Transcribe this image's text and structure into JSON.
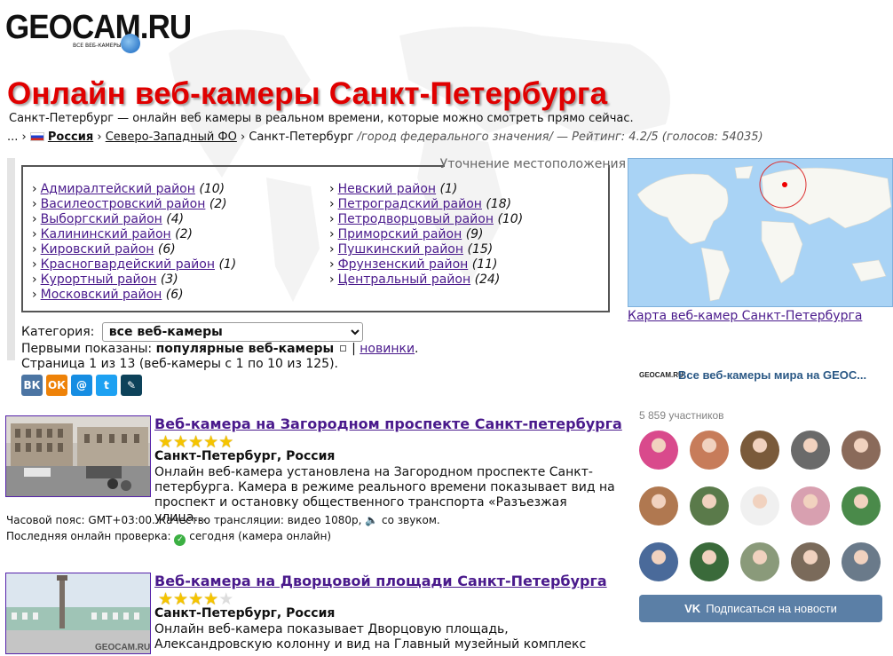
{
  "logo": {
    "text": "GEOCAM.RU",
    "sub": "ВСЕ ВЕБ-КАМЕРЫ МИРА"
  },
  "page_title": "Онлайн веб-камеры Санкт-Петербурга",
  "subtitle": "Санкт-Петербург — онлайн веб камеры в реальном времени, которые можно смотреть прямо сейчас.",
  "breadcrumb": {
    "ellipsis": "... ›",
    "country": "Россия",
    "sep1": "›",
    "district": "Северо-Западный ФО",
    "sep2": "›",
    "city": "Санкт-Петербург",
    "note": "/город федерального значения/ — Рейтинг: 4.2/5 (голосов: 54035)"
  },
  "location_box": {
    "legend": "Уточнение местоположения",
    "arrow": "›",
    "col1": [
      {
        "name": "Адмиралтейский район",
        "count": "(10)"
      },
      {
        "name": "Василеостровский район",
        "count": "(2)"
      },
      {
        "name": "Выборгский район",
        "count": "(4)"
      },
      {
        "name": "Калининский район",
        "count": "(2)"
      },
      {
        "name": "Кировский район",
        "count": "(6)"
      },
      {
        "name": "Красногвардейский район",
        "count": "(1)"
      },
      {
        "name": "Курортный район",
        "count": "(3)"
      },
      {
        "name": "Московский район",
        "count": "(6)"
      }
    ],
    "col2": [
      {
        "name": "Невский район",
        "count": "(1)"
      },
      {
        "name": "Петроградский район",
        "count": "(18)"
      },
      {
        "name": "Петродворцовый район",
        "count": "(10)"
      },
      {
        "name": "Приморский район",
        "count": "(9)"
      },
      {
        "name": "Пушкинский район",
        "count": "(15)"
      },
      {
        "name": "Фрунзенский район",
        "count": "(11)"
      },
      {
        "name": "Центральный район",
        "count": "(24)"
      }
    ]
  },
  "category": {
    "label": "Категория:",
    "selected": "все веб-камеры"
  },
  "shown": {
    "label": "Первыми показаны:",
    "popular": "популярные веб-камеры",
    "sep": "|",
    "new": "новинки",
    "dot": "."
  },
  "page_info": "Страница 1 из 13 (веб-камеры с 1 по 10 из 125).",
  "share": {
    "vk": "ВК",
    "ok": "ОК",
    "mm": "@",
    "tw": "t",
    "lj": "✎",
    "colors": {
      "vk": "#4c75a3",
      "ok": "#ee8208",
      "mm": "#168de2",
      "tw": "#1da1f2",
      "lj": "#0d425a"
    }
  },
  "cams": [
    {
      "title": "Веб-камера на Загородном проспекте Санкт-петербурга",
      "rating": 5,
      "location": "Санкт-Петербург, Россия",
      "desc": "Онлайн веб-камера установлена на Загородном проспекте Санкт-петербурга. Камера в режиме реального времени показывает вид на проспект и остановку общественного транспорта «Разъезжая улица…",
      "tz": "Часовой пояс: GMT+03:00. Качество трансляции: видео 1080p, 🔈 со звуком.",
      "check_label": "Последняя онлайн проверка:",
      "check_value": "сегодня (камера онлайн)"
    },
    {
      "title": "Веб-камера на Дворцовой площади Санкт-Петербурга",
      "rating": 4,
      "location": "Санкт-Петербург, Россия",
      "desc": "Онлайн веб-камера показывает Дворцовую площадь, Александровскую колонну и вид на Главный музейный комплекс"
    }
  ],
  "map_link": "Карта веб-камер Санкт-Петербурга",
  "vk_widget": {
    "logo": "GEOCAM.RU",
    "name": "Все веб-камеры мира на GEOC...",
    "members": "5 859 участников",
    "button": "Подписаться на новости",
    "avatar_colors": [
      "#d94a8c",
      "#c77c5a",
      "#7a5a3a",
      "#6a6a6a",
      "#8a6a5a",
      "#b07850",
      "#5a7a4a",
      "#f0f0f0",
      "#d8a0b0",
      "#4a8a4a",
      "#4a6a9a",
      "#3a6a3a",
      "#8a9a7a",
      "#7a6a5a",
      "#6a7a8a"
    ]
  },
  "colors": {
    "title_red": "#e00000",
    "link_purple": "#4a1a8c",
    "star": "#f5c400"
  }
}
